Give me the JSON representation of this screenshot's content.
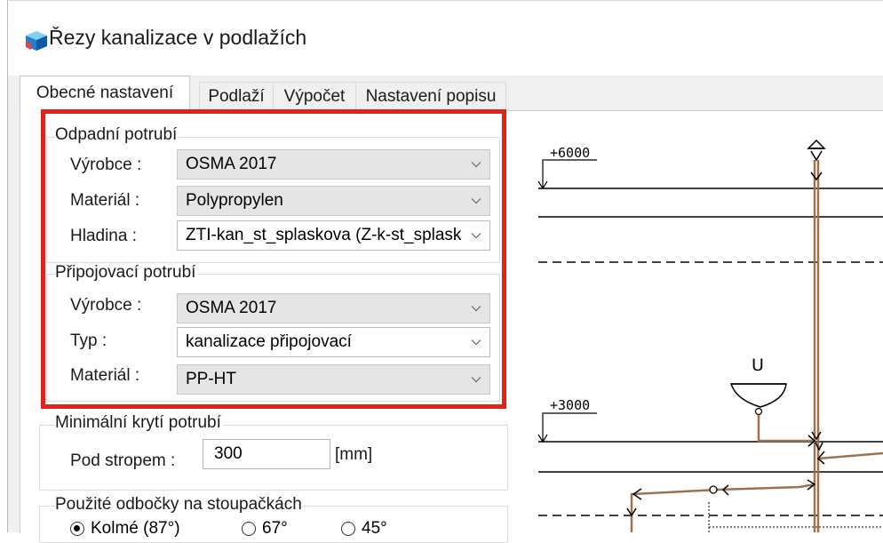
{
  "window": {
    "title": "Řezy kanalizace v podlažích",
    "icon": "3d-box-app-icon"
  },
  "tabs": [
    {
      "label": "Obecné nastavení",
      "active": true
    },
    {
      "label": "Podlaží",
      "active": false
    },
    {
      "label": "Výpočet",
      "active": false
    },
    {
      "label": "Nastavení popisu",
      "active": false
    }
  ],
  "waste_pipe": {
    "group_label": "Odpadní potrubí",
    "manufacturer_label": "Výrobce :",
    "manufacturer_value": "OSMA 2017",
    "material_label": "Materiál :",
    "material_value": "Polypropylen",
    "layer_label": "Hladina :",
    "layer_value": "ZTI-kan_st_splaskova  (Z-k-st_splaskova)"
  },
  "connecting_pipe": {
    "group_label": "Připojovací potrubí",
    "manufacturer_label": "Výrobce :",
    "manufacturer_value": "OSMA 2017",
    "type_label": "Typ :",
    "type_value": "kanalizace připojovací",
    "material_label": "Materiál :",
    "material_value": "PP-HT"
  },
  "min_cover": {
    "group_label": "Minimální krytí potrubí",
    "below_ceiling_label": "Pod stropem :",
    "below_ceiling_value": "300",
    "unit": "[mm]"
  },
  "branches": {
    "group_label": "Použité odbočky na stoupačkách",
    "options": [
      {
        "label": "Kolmé (87°)",
        "selected": true
      },
      {
        "label": "67°",
        "selected": false
      },
      {
        "label": "45°",
        "selected": false
      }
    ]
  },
  "preview": {
    "level_upper": "+6000",
    "level_lower": "+3000",
    "fixture_label": "U"
  },
  "colors": {
    "highlight": "#e2231a",
    "pipe": "#9c7250"
  }
}
